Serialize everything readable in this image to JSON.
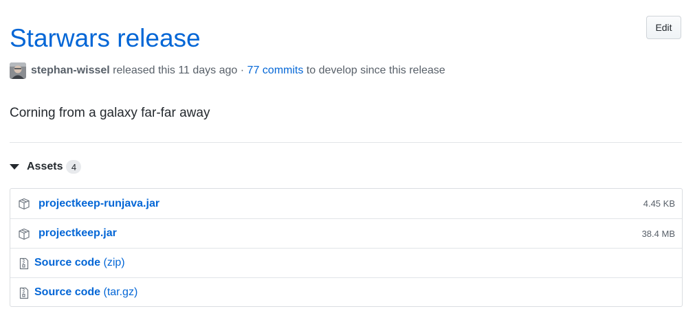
{
  "release": {
    "title": "Starwars release",
    "edit_label": "Edit",
    "author": "stephan-wissel",
    "released_text": "released this 11 days ago ·",
    "commits_link": "77 commits",
    "commits_suffix": "to develop since this release",
    "body": "Corning from a galaxy far-far away"
  },
  "assets": {
    "label": "Assets",
    "count": "4",
    "items": [
      {
        "name": "projectkeep-runjava.jar",
        "size": "4.45 KB",
        "icon": "package-icon"
      },
      {
        "name": "projectkeep.jar",
        "size": "38.4 MB",
        "icon": "package-icon"
      }
    ],
    "source_code": [
      {
        "label": "Source code",
        "format": "(zip)",
        "icon": "file-zip-icon"
      },
      {
        "label": "Source code",
        "format": "(tar.gz)",
        "icon": "file-zip-icon"
      }
    ]
  },
  "colors": {
    "link": "#0366d6",
    "muted": "#586069",
    "text": "#24292e",
    "border": "#e1e4e8"
  }
}
